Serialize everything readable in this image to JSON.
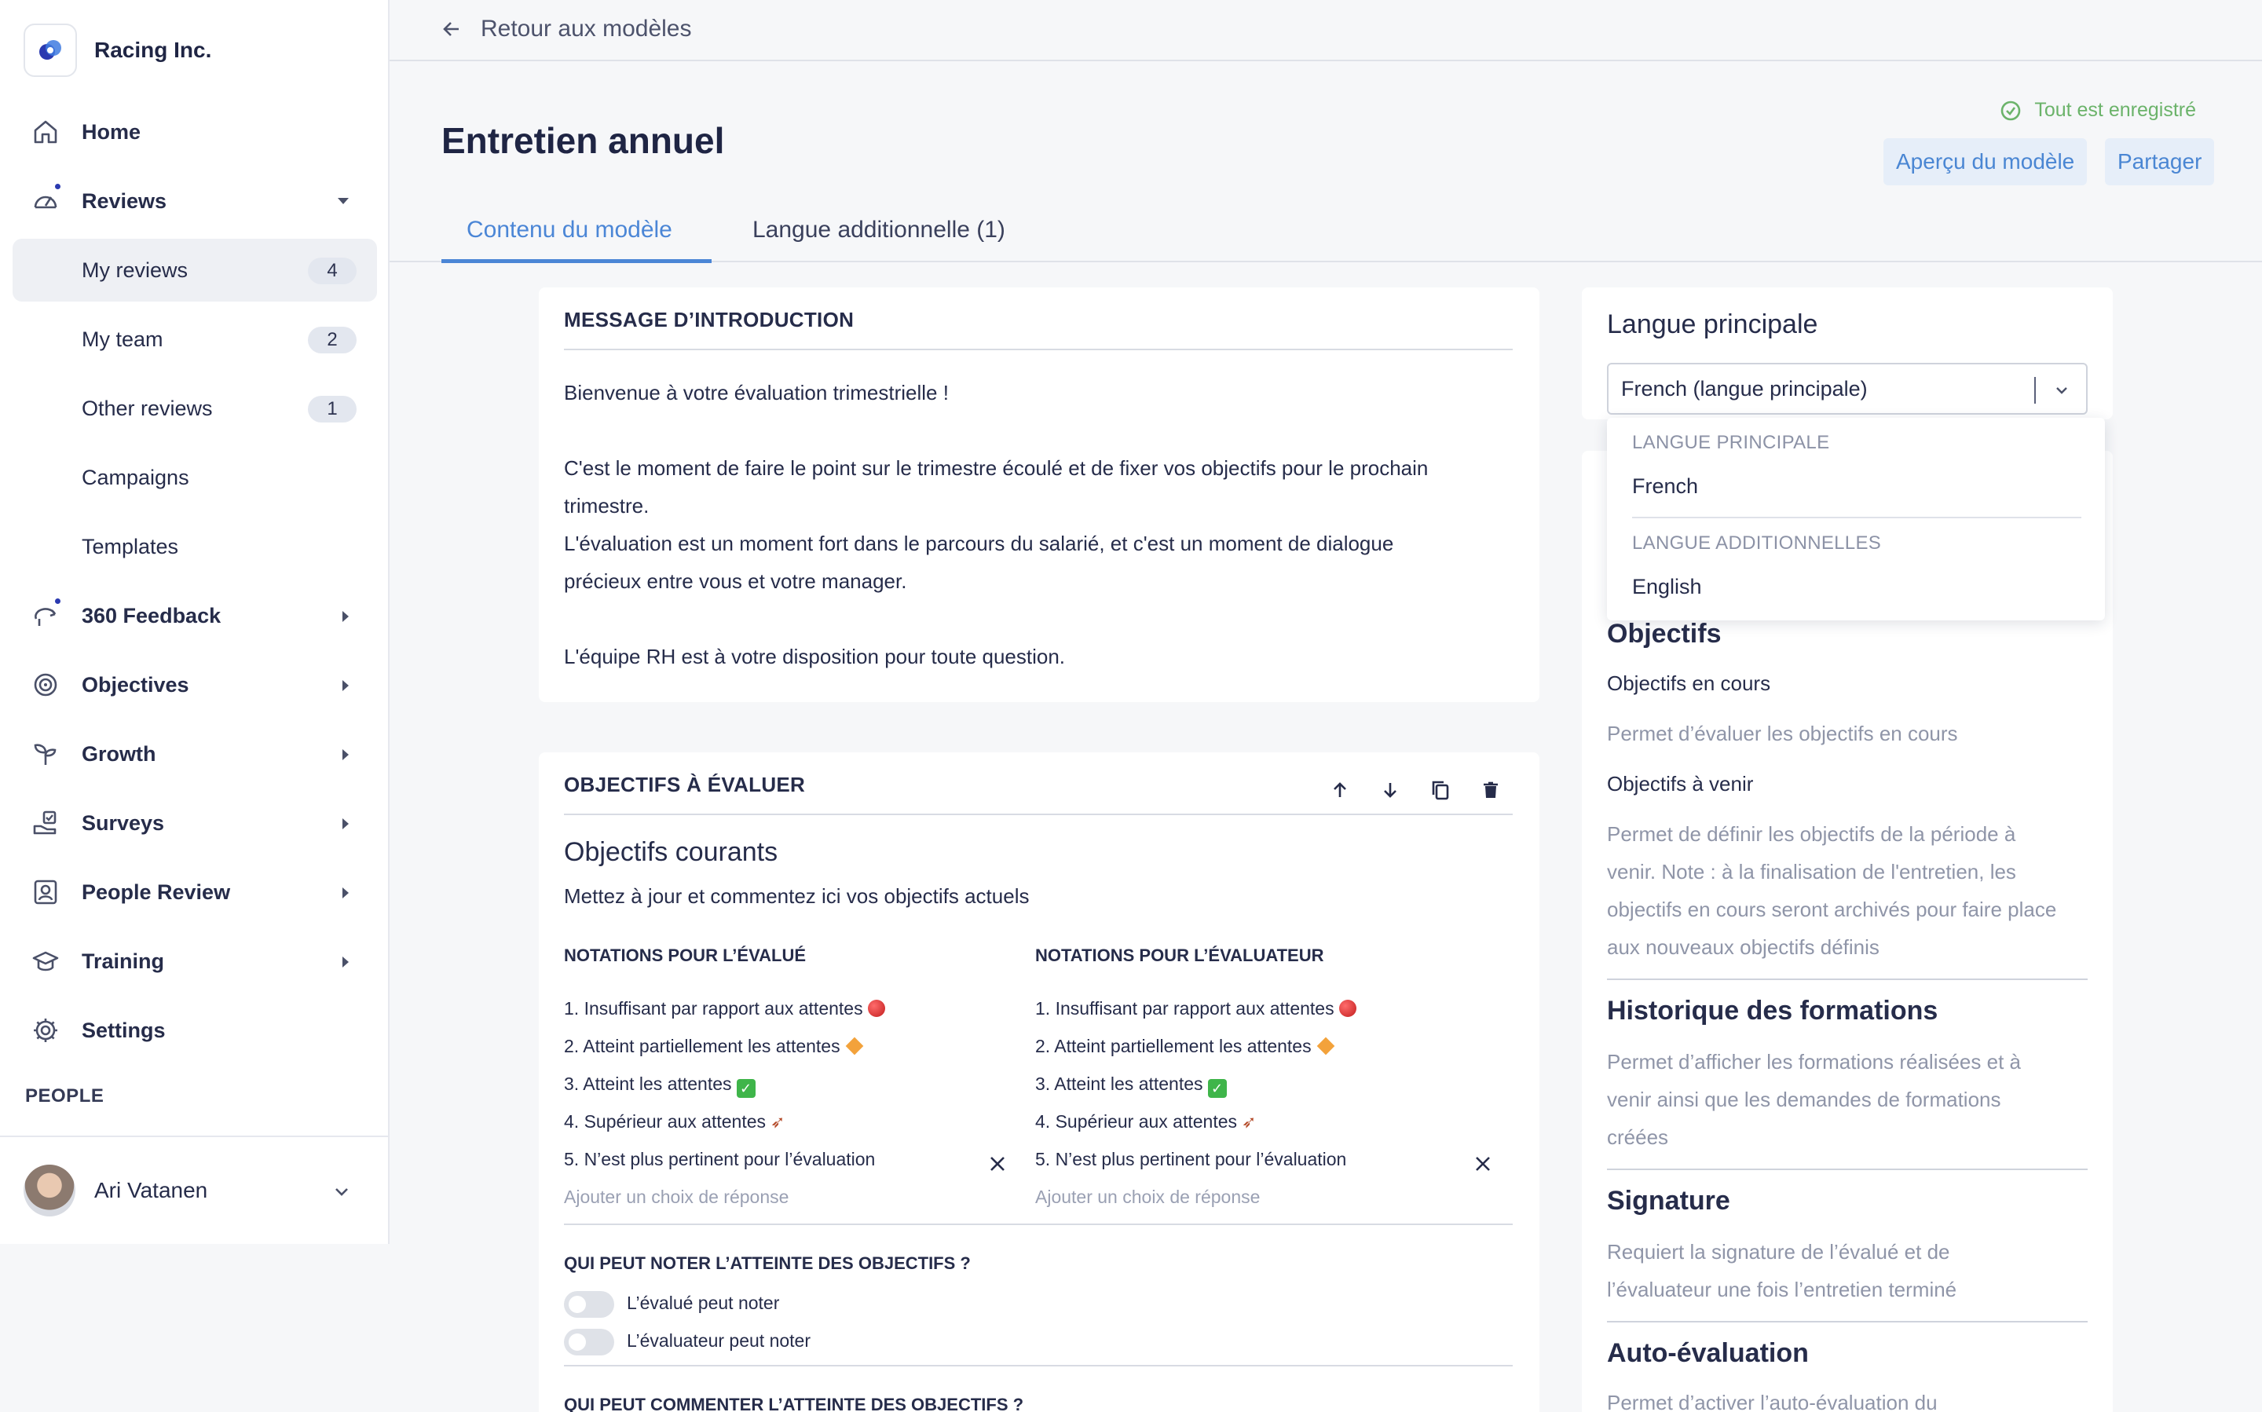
{
  "brand": {
    "name": "Racing Inc."
  },
  "nav": {
    "home": "Home",
    "reviews": "Reviews",
    "my_reviews": "My reviews",
    "my_reviews_count": "4",
    "my_team": "My team",
    "my_team_count": "2",
    "other_reviews": "Other reviews",
    "other_reviews_count": "1",
    "campaigns": "Campaigns",
    "templates": "Templates",
    "feedback360": "360 Feedback",
    "objectives": "Objectives",
    "growth": "Growth",
    "surveys": "Surveys",
    "people_review": "People Review",
    "training": "Training",
    "settings": "Settings",
    "people_section": "PEOPLE"
  },
  "user": {
    "name": "Ari Vatanen"
  },
  "topbar": {
    "back_label": "Retour aux modèles"
  },
  "header": {
    "title": "Entretien annuel",
    "saved_status": "Tout est enregistré",
    "preview_button": "Aperçu du modèle",
    "share_button": "Partager"
  },
  "tabs": [
    {
      "label": "Contenu du modèle",
      "active": true
    },
    {
      "label": "Langue additionnelle (1)",
      "active": false
    }
  ],
  "intro": {
    "heading": "MESSAGE D’INTRODUCTION",
    "line1": "Bienvenue à votre évaluation trimestrielle !",
    "line2": "C'est le moment de faire le point sur le trimestre écoulé et de fixer vos objectifs pour le prochain",
    "line3": "trimestre.",
    "line4": "L'évaluation est un moment fort dans le parcours du salarié, et c'est un moment de dialogue",
    "line5": "précieux entre vous et votre manager.",
    "line6": "L'équipe RH est à votre disposition pour toute question."
  },
  "objectives_card": {
    "heading": "OBJECTIFS À ÉVALUER",
    "title": "Objectifs courants",
    "subtitle": "Mettez à jour et commentez ici vos objectifs actuels",
    "evaluee_heading": "NOTATIONS POUR L’ÉVALUÉ",
    "evaluator_heading": "NOTATIONS POUR L’ÉVALUATEUR",
    "ratings": [
      "1. Insuffisant par rapport aux attentes",
      "2. Atteint partiellement les attentes",
      "3. Atteint les attentes",
      "4. Supérieur aux attentes",
      "5. N’est plus pertinent pour l’évaluation"
    ],
    "add_choice_placeholder": "Ajouter un choix de réponse",
    "who_rates_heading": "QUI PEUT NOTER L’ATTEINTE DES OBJECTIFS ?",
    "evaluee_can_rate": "L’évalué peut noter",
    "evaluator_can_rate": "L’évaluateur peut noter",
    "who_comments_heading": "QUI PEUT COMMENTER L’ATTEINTE DES OBJECTIFS ?"
  },
  "right_panel": {
    "language_title": "Langue principale",
    "language_value": "French (langue principale)",
    "dropdown": {
      "group_main": "LANGUE PRINCIPALE",
      "option_main": "French",
      "group_additional": "LANGUE ADDITIONNELLES",
      "option_additional": "English"
    },
    "objectives_title": "Objectifs",
    "current_objectives": "Objectifs en cours",
    "current_objectives_desc": "Permet d’évaluer les objectifs en cours",
    "next_objectives": "Objectifs à venir",
    "next_objectives_desc_1": "Permet de définir les objectifs de la période à",
    "next_objectives_desc_2": "venir. Note : à la finalisation de l'entretien, les",
    "next_objectives_desc_3": "objectifs en cours seront archivés pour faire place",
    "next_objectives_desc_4": "aux nouveaux objectifs définis",
    "training_title": "Historique des formations",
    "training_desc_1": "Permet d’afficher les formations réalisées et à",
    "training_desc_2": "venir ainsi que les demandes de formations",
    "training_desc_3": "créées",
    "signature_title": "Signature",
    "signature_desc_1": "Requiert la signature de l’évalué et de",
    "signature_desc_2": "l’évaluateur une fois l’entretien terminé",
    "self_eval_title": "Auto-évaluation",
    "self_eval_desc_1": "Permet d’activer l’auto-évaluation du"
  },
  "colors": {
    "accent": "#4b86d6",
    "success": "#6bb36a",
    "brand": "#2b3ab0"
  }
}
